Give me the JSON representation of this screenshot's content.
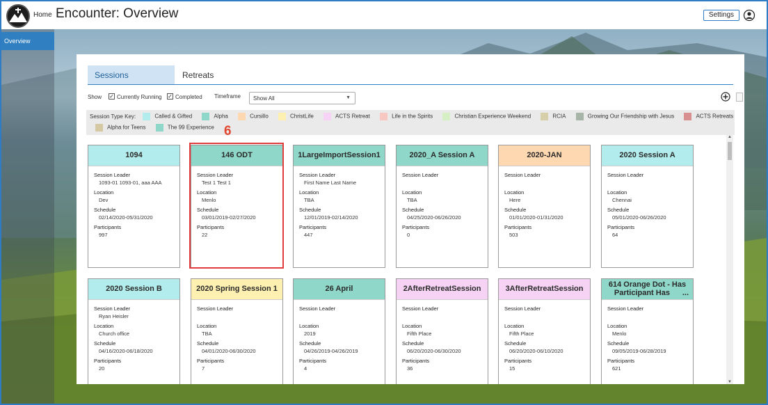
{
  "header": {
    "home_label": "Home",
    "title": "Encounter: Overview",
    "settings_label": "Settings"
  },
  "sidebar": {
    "items": [
      {
        "label": "Overview"
      }
    ]
  },
  "tabs": [
    {
      "label": "Sessions"
    },
    {
      "label": "Retreats"
    }
  ],
  "filters": {
    "show_label": "Show",
    "currently_running_label": "Currently Running",
    "currently_running_checked": true,
    "completed_label": "Completed",
    "completed_checked": true,
    "timeframe_label": "Timeframe",
    "timeframe_value": "Show All"
  },
  "key": {
    "label": "Session Type Key:",
    "items": [
      {
        "name": "Called & Gifted",
        "color": "#b3ecec"
      },
      {
        "name": "Alpha",
        "color": "#8fd7c8"
      },
      {
        "name": "Cursillo",
        "color": "#fdd8b0"
      },
      {
        "name": "ChristLife",
        "color": "#fdf0b0"
      },
      {
        "name": "ACTS Retreat",
        "color": "#f6d3f4"
      },
      {
        "name": "Life in the Spirits",
        "color": "#f7c8c2"
      },
      {
        "name": "Christian Experience Weekend",
        "color": "#d6efc4"
      },
      {
        "name": "RCIA",
        "color": "#d7ceaa"
      },
      {
        "name": "Growing Our Friendship with Jesus",
        "color": "#a6b5a8"
      },
      {
        "name": "ACTS Retreats",
        "color": "#d89090"
      },
      {
        "name": "Alpha for Teens",
        "color": "#d5c9a3"
      },
      {
        "name": "The 99 Experience",
        "color": "#8fd7c8"
      }
    ]
  },
  "field_labels": {
    "leader": "Session Leader",
    "location": "Location",
    "schedule": "Schedule",
    "participants": "Participants"
  },
  "cards": [
    {
      "title": "1094",
      "color": "#b3ecec",
      "leader": "1093-01 1093-01, aaa AAA",
      "location": "Dev",
      "schedule": "02/14/2020-05/31/2020",
      "participants": "997"
    },
    {
      "title": "146 ODT",
      "color": "#8fd7c8",
      "leader": "Test 1 Test 1",
      "location": "Menlo",
      "schedule": "03/01/2019-02/27/2020",
      "participants": "22"
    },
    {
      "title": "1LargeImportSession1",
      "color": "#8fd7c8",
      "leader": "First Name Last Name",
      "location": "TBA",
      "schedule": "12/01/2019-02/14/2020",
      "participants": "447"
    },
    {
      "title": "2020_A Session A",
      "color": "#8fd7c8",
      "leader": "",
      "location": "TBA",
      "schedule": "04/25/2020-06/26/2020",
      "participants": "0"
    },
    {
      "title": "2020-JAN",
      "color": "#fdd8b0",
      "leader": "",
      "location": "Here",
      "schedule": "01/01/2020-01/31/2020",
      "participants": "503"
    },
    {
      "title": "2020 Session A",
      "color": "#b3ecec",
      "leader": "",
      "location": "Chennai",
      "schedule": "05/01/2020-06/26/2020",
      "participants": "64"
    },
    {
      "title": "2020 Session B",
      "color": "#b3ecec",
      "leader": "Ryan Heisler",
      "location": "Church office",
      "schedule": "04/16/2020-06/18/2020",
      "participants": "20"
    },
    {
      "title": "2020 Spring Session 1",
      "color": "#fdf0b0",
      "leader": "",
      "location": "TBA",
      "schedule": "04/01/2020-06/30/2020",
      "participants": "7"
    },
    {
      "title": "26 April",
      "color": "#8fd7c8",
      "leader": "",
      "location": "2019",
      "schedule": "04/26/2019-04/26/2019",
      "participants": "4"
    },
    {
      "title": "2AfterRetreatSession",
      "color": "#f6d3f4",
      "leader": "",
      "location": "Fifth Place",
      "schedule": "06/20/2020-06/30/2020",
      "participants": "36"
    },
    {
      "title": "3AfterRetreatSession",
      "color": "#f6d3f4",
      "leader": "",
      "location": "Fifth Place",
      "schedule": "06/20/2020-06/10/2020",
      "participants": "15"
    },
    {
      "title": "614 Orange Dot - Has Participant Has",
      "title_line1": "614 Orange Dot - Has",
      "title_line2": "Participant Has",
      "title_ellipsis": "...",
      "color": "#8fd7c8",
      "leader": "",
      "location": "Menlo",
      "schedule": "09/05/2019-06/28/2019",
      "participants": "621"
    }
  ],
  "annotation": {
    "marker": "6"
  }
}
